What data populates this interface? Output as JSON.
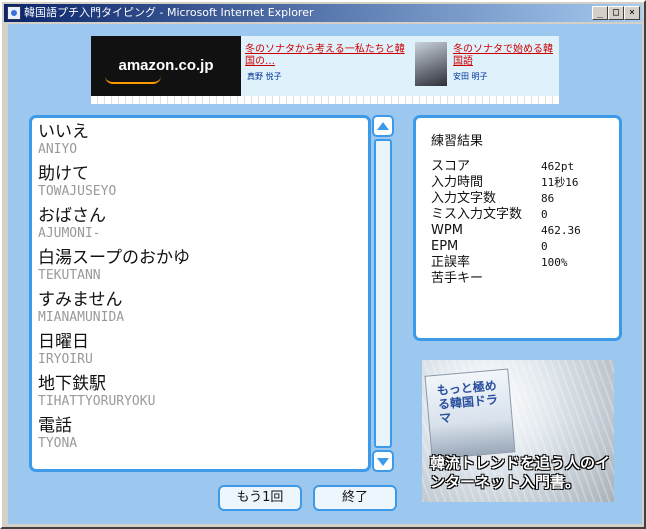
{
  "window": {
    "title": "韓国語プチ入門タイピング - Microsoft Internet Explorer",
    "buttons": {
      "minimize": "_",
      "maximize": "□",
      "close": "×"
    }
  },
  "banner": {
    "logo": "amazon.co.jp",
    "items": [
      {
        "title": "冬のソナタから考える一私たちと韓国の…",
        "author": "真野 悦子"
      },
      {
        "title": "冬のソナタで始める韓国語",
        "author": "安田 明子"
      }
    ]
  },
  "words": [
    {
      "jp": "いいえ",
      "romaji": "ANIYO"
    },
    {
      "jp": "助けて",
      "romaji": "TOWAJUSEYO"
    },
    {
      "jp": "おばさん",
      "romaji": "AJUMONI-"
    },
    {
      "jp": "白湯スープのおかゆ",
      "romaji": "TEKUTANN"
    },
    {
      "jp": "すみません",
      "romaji": "MIANAMUNIDA"
    },
    {
      "jp": "日曜日",
      "romaji": "IRYOIRU"
    },
    {
      "jp": "地下鉄駅",
      "romaji": "TIHATTYORURYOKU"
    },
    {
      "jp": "電話",
      "romaji": "TYONA"
    }
  ],
  "results": {
    "title": "練習結果",
    "stats": [
      {
        "label": "スコア",
        "value": "462pt"
      },
      {
        "label": "入力時間",
        "value": "11秒16"
      },
      {
        "label": "入力文字数",
        "value": "86"
      },
      {
        "label": "ミス入力文字数",
        "value": "0"
      },
      {
        "label": "WPM",
        "value": "462.36"
      },
      {
        "label": "EPM",
        "value": "0"
      },
      {
        "label": "正誤率",
        "value": "100%"
      },
      {
        "label": "苦手キー",
        "value": ""
      }
    ]
  },
  "book_ad": {
    "book_title": "もっと極める韓国ドラマ",
    "tagline": "韓流トレンドを追う人のインターネット入門書。"
  },
  "buttons": {
    "retry": "もう1回",
    "finish": "終了"
  },
  "colors": {
    "accent": "#3d9ae8",
    "background": "#9cc8ef",
    "title_bar": "#0a246a",
    "ad_link": "#cc0000"
  }
}
